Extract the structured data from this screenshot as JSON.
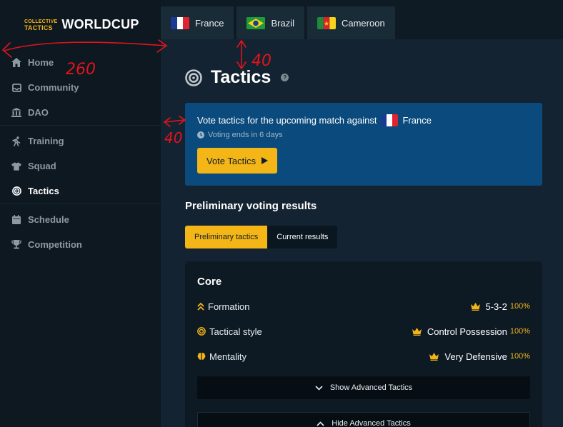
{
  "logo": {
    "small_top": "COLLECTIVE",
    "small_bottom": "TACTICS",
    "big": "WORLDCUP"
  },
  "sidebar": {
    "items": [
      {
        "label": "Home",
        "icon": "home-icon"
      },
      {
        "label": "Community",
        "icon": "inbox-icon"
      },
      {
        "label": "DAO",
        "icon": "bank-icon"
      },
      {
        "label": "Training",
        "icon": "runner-icon"
      },
      {
        "label": "Squad",
        "icon": "shirt-icon"
      },
      {
        "label": "Tactics",
        "icon": "target-icon",
        "active": true
      },
      {
        "label": "Schedule",
        "icon": "calendar-icon"
      },
      {
        "label": "Competition",
        "icon": "trophy-icon"
      }
    ]
  },
  "tabs": [
    {
      "label": "France"
    },
    {
      "label": "Brazil"
    },
    {
      "label": "Cameroon"
    }
  ],
  "page": {
    "title": "Tactics",
    "help": "?"
  },
  "vote": {
    "text": "Vote tactics for the upcoming match against",
    "opponent": "France",
    "ends": "Voting ends in 6 days",
    "button": "Vote Tactics"
  },
  "results": {
    "title": "Preliminary voting results",
    "toggle_active": "Preliminary tactics",
    "toggle_inactive": "Current results"
  },
  "core": {
    "title": "Core",
    "rows": [
      {
        "label": "Formation",
        "value": "5-3-2",
        "pct": "100%"
      },
      {
        "label": "Tactical style",
        "value": "Control Possession",
        "pct": "100%"
      },
      {
        "label": "Mentality",
        "value": "Very Defensive",
        "pct": "100%"
      }
    ],
    "show_advanced": "Show Advanced Tactics",
    "hide_advanced": "Hide Advanced Tactics"
  },
  "annotations": {
    "a1": "260",
    "a2": "40",
    "a3": "40"
  },
  "colors": {
    "accent": "#f4b516",
    "vote_bg": "#0a4a7c",
    "annotation": "#e0141c"
  }
}
